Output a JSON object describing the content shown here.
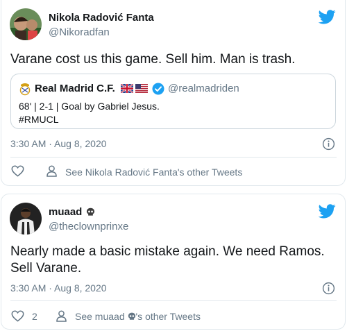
{
  "tweet1": {
    "author_name": "Nikola Radović Fanta",
    "author_handle": "@Nikoradfan",
    "text": "Varane cost us this game. Sell him. Man is trash.",
    "quote": {
      "name": "Real Madrid C.F.",
      "handle": "@realmadriden",
      "line1": "68' | 2-1 | Goal by Gabriel Jesus.",
      "line2": "#RMUCL"
    },
    "timestamp": "3:30 AM · Aug 8, 2020",
    "like_count": "",
    "profile_link": "See Nikola Radović Fanta's other Tweets"
  },
  "tweet2": {
    "author_name": "muaad",
    "author_handle": "@theclownprinxe",
    "text_line1": "Nearly made a basic mistake again. We need Ramos.",
    "text_line2": "Sell Varane.",
    "timestamp": "3:30 AM · Aug 8, 2020",
    "like_count": "2",
    "profile_link_pre": "See muaad ",
    "profile_link_post": "'s other Tweets"
  },
  "colors": {
    "twitter_blue": "#1da1f2",
    "text_primary": "#14171a",
    "text_secondary": "#657786",
    "border": "#e1e8ed"
  },
  "icons": [
    "twitter-bird-icon",
    "info-icon",
    "heart-icon",
    "person-icon",
    "verified-badge-icon",
    "uk-flag-icon",
    "us-flag-icon",
    "real-madrid-crest-icon",
    "skull-emoji-icon"
  ]
}
